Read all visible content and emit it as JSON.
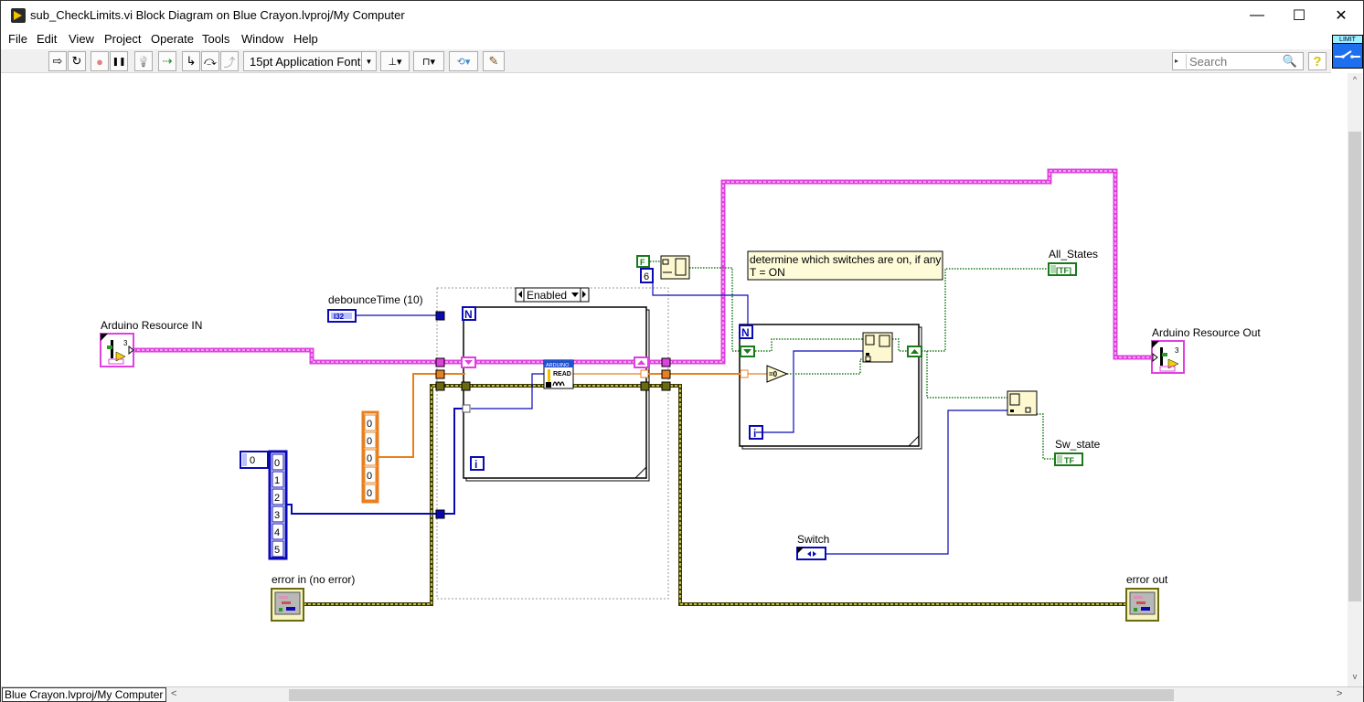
{
  "window": {
    "title": "sub_CheckLimits.vi Block Diagram on Blue Crayon.lvproj/My Computer",
    "minimize": "—",
    "maximize": "☐",
    "close": "✕"
  },
  "menu": [
    "File",
    "Edit",
    "View",
    "Project",
    "Operate",
    "Tools",
    "Window",
    "Help"
  ],
  "toolbar": {
    "run": "⇨",
    "run_continuously": "↻",
    "abort": "●",
    "pause": "❚❚",
    "highlight_execution": "💡",
    "retain_wire_values": "⇢",
    "step_into": "↳",
    "step_over": "⤼",
    "step_out": "⤴",
    "font": "15pt Application Font",
    "font_dropdown": "▼",
    "align": "⊥▾",
    "distribute": "⊓▾",
    "reorder": "⟲▾",
    "cleanup": "✎"
  },
  "search": {
    "placeholder": "Search",
    "icon": "search-icon"
  },
  "help": "?",
  "vi_icon": {
    "label": "LIMIT"
  },
  "diagram": {
    "controls": {
      "arduino_in": {
        "label": "Arduino Resource IN",
        "badge": "3"
      },
      "debounce": {
        "label": "debounceTime (10)",
        "type": "I32"
      },
      "error_in": {
        "label": "error in (no error)"
      },
      "switch": {
        "label": "Switch"
      }
    },
    "indicators": {
      "arduino_out": {
        "label": "Arduino Resource Out",
        "badge": "3"
      },
      "all_states": {
        "label": "All_States",
        "type": "[TF]"
      },
      "sw_state": {
        "label": "Sw_state",
        "type": "TF"
      },
      "error_out": {
        "label": "error out"
      }
    },
    "constants": {
      "pin_array_index": "0",
      "pin_array": [
        "0",
        "1",
        "2",
        "3",
        "4",
        "5"
      ],
      "zero_array": [
        "0",
        "0",
        "0",
        "0",
        "0"
      ],
      "false_const": "F",
      "size_const": "6"
    },
    "structures": {
      "disable_case": "Enabled",
      "loop_count": "N",
      "loop_index": "i",
      "arduino_read": {
        "header": "ARDUINO",
        "label": "READ"
      },
      "equal_zero": "=0"
    },
    "comment": [
      "determine which switches are on, if any",
      "T = ON"
    ]
  },
  "statusbar": {
    "context": "Blue Crayon.lvproj/My Computer",
    "scroll_left": "<",
    "scroll_right": ">",
    "scroll_up": "^",
    "scroll_down": "v"
  }
}
